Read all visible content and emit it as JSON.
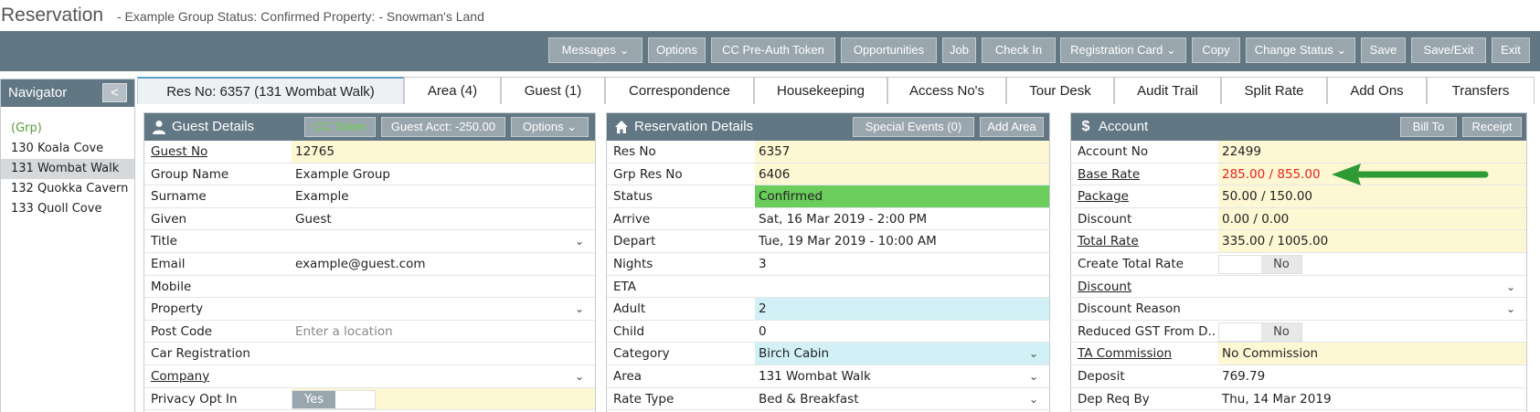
{
  "title": {
    "main": "Reservation",
    "sub": "- Example Group   Status: Confirmed Property: - Snowman's Land"
  },
  "toolbar": {
    "buttons": [
      "Messages ⌄",
      "Options",
      "CC Pre-Auth Token",
      "Opportunities",
      "Job",
      "Check In",
      "Registration Card ⌄",
      "Copy",
      "Change Status ⌄",
      "Save",
      "Save/Exit",
      "Exit"
    ]
  },
  "navigator": {
    "title": "Navigator",
    "collapse": "<",
    "items": [
      "(Grp)",
      "130 Koala Cove",
      "131 Wombat Walk",
      "132 Quokka Cavern",
      "133 Quoll Cove"
    ]
  },
  "tabs": [
    "Res No: 6357 (131 Wombat Walk)",
    "Area (4)",
    "Guest (1)",
    "Correspondence",
    "Housekeeping",
    "Access No's",
    "Tour Desk",
    "Audit Trail",
    "Split Rate",
    "Add Ons",
    "Transfers"
  ],
  "guest": {
    "title": "Guest Details",
    "buttons": [
      "CC Token",
      "Guest Acct: -250.00",
      "Options ⌄"
    ],
    "rows": [
      {
        "label": "Guest No",
        "value": "12765"
      },
      {
        "label": "Group Name",
        "value": "Example Group"
      },
      {
        "label": "Surname",
        "value": "Example"
      },
      {
        "label": "Given",
        "value": "Guest"
      },
      {
        "label": "Title",
        "value": ""
      },
      {
        "label": "Email",
        "value": "example@guest.com"
      },
      {
        "label": "Mobile",
        "value": ""
      },
      {
        "label": "Property",
        "value": ""
      },
      {
        "label": "Post Code",
        "value": "Enter a location"
      },
      {
        "label": "Car Registration",
        "value": ""
      },
      {
        "label": "Company",
        "value": ""
      },
      {
        "label": "Privacy Opt In",
        "value": "Yes"
      }
    ]
  },
  "reservation": {
    "title": "Reservation Details",
    "buttons": [
      "Special Events (0)",
      "Add Area"
    ],
    "rows": [
      {
        "label": "Res No",
        "value": "6357"
      },
      {
        "label": "Grp Res No",
        "value": "6406"
      },
      {
        "label": "Status",
        "value": "Confirmed"
      },
      {
        "label": "Arrive",
        "value": "Sat, 16 Mar 2019 - 2:00 PM"
      },
      {
        "label": "Depart",
        "value": "Tue, 19 Mar 2019 - 10:00 AM"
      },
      {
        "label": "Nights",
        "value": "3"
      },
      {
        "label": "ETA",
        "value": ""
      },
      {
        "label": "Adult",
        "value": "2"
      },
      {
        "label": "Child",
        "value": "0"
      },
      {
        "label": "Category",
        "value": "Birch Cabin"
      },
      {
        "label": "Area",
        "value": "131 Wombat Walk"
      },
      {
        "label": "Rate Type",
        "value": "Bed & Breakfast"
      }
    ]
  },
  "account": {
    "title": "Account",
    "buttons": [
      "Bill To",
      "Receipt"
    ],
    "rows": [
      {
        "label": "Account No",
        "value": "22499"
      },
      {
        "label": "Base Rate",
        "value": "285.00 / 855.00"
      },
      {
        "label": "Package",
        "value": "50.00 / 150.00"
      },
      {
        "label": "Discount",
        "value": "0.00 / 0.00"
      },
      {
        "label": "Total Rate",
        "value": "335.00 / 1005.00"
      },
      {
        "label": "Create Total Rate",
        "value": "No"
      },
      {
        "label": "Discount",
        "value": ""
      },
      {
        "label": "Discount Reason",
        "value": ""
      },
      {
        "label": "Reduced GST From D...",
        "value": "No"
      },
      {
        "label": "TA Commission",
        "value": "No Commission"
      },
      {
        "label": "Deposit",
        "value": "769.79"
      },
      {
        "label": "Dep Req By",
        "value": "Thu, 14 Mar 2019"
      }
    ]
  },
  "colors": {
    "toolbar": "#617784",
    "button": "#9aa6ae",
    "confirmed": "#6acd5c",
    "highlight": "#e8221b",
    "arrow": "#2e9a33"
  },
  "icons": {
    "guest_panel": "user-icon",
    "reservation_panel": "home-icon",
    "account_panel": "dollar-icon",
    "dropdown": "chevron-down-icon",
    "annotation": "arrow-left-icon"
  }
}
